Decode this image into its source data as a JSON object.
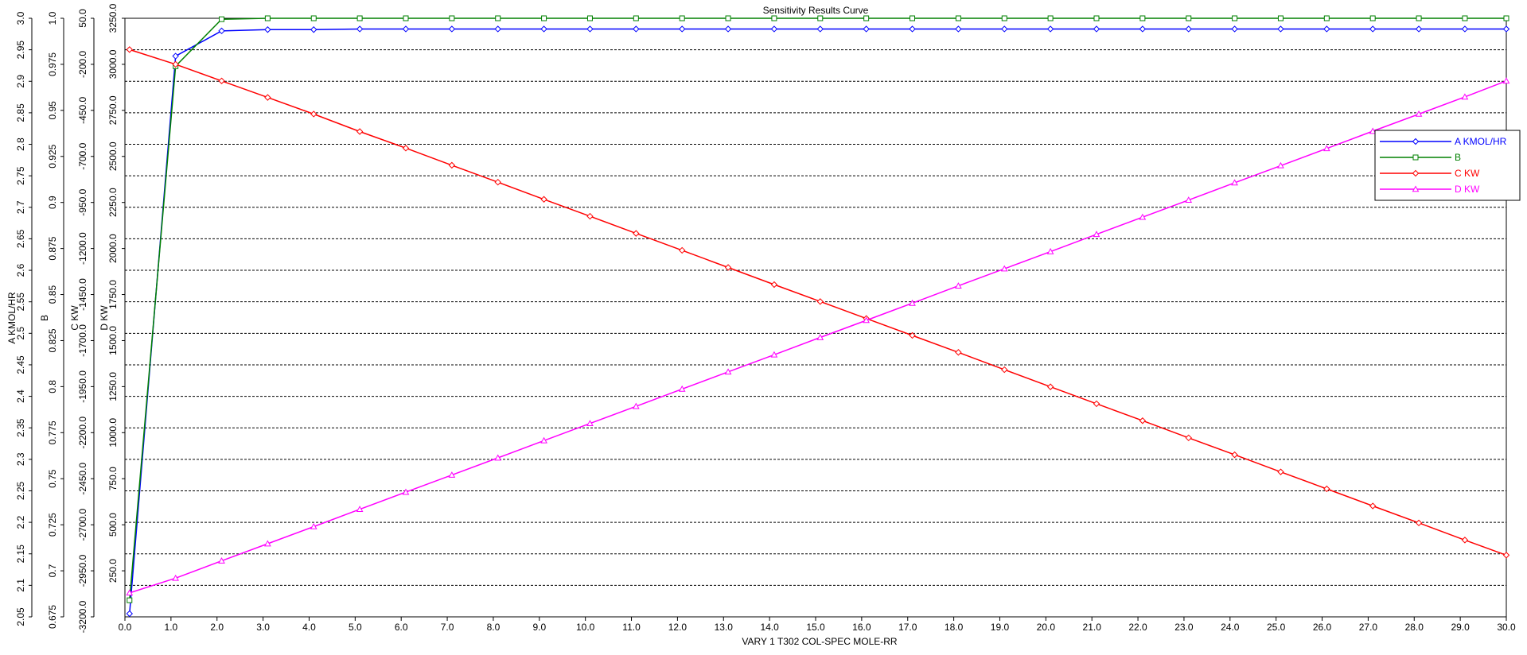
{
  "chart_data": {
    "type": "line",
    "title": "Sensitivity Results Curve",
    "xlabel": "VARY   1 T302 COL-SPEC MOLE-RR",
    "xlim": [
      0.0,
      30.0
    ],
    "xticks": [
      "0.0",
      "1.0",
      "2.0",
      "3.0",
      "4.0",
      "5.0",
      "6.0",
      "7.0",
      "8.0",
      "9.0",
      "10.0",
      "11.0",
      "12.0",
      "13.0",
      "14.0",
      "15.0",
      "16.0",
      "17.0",
      "18.0",
      "19.0",
      "20.0",
      "21.0",
      "22.0",
      "23.0",
      "24.0",
      "25.0",
      "26.0",
      "27.0",
      "28.0",
      "29.0",
      "30.0"
    ],
    "axes": [
      {
        "id": "A",
        "label": "A KMOL/HR",
        "ylim": [
          2.05,
          3.0
        ],
        "ticks": [
          "2.05",
          "2.1",
          "2.15",
          "2.2",
          "2.25",
          "2.3",
          "2.35",
          "2.4",
          "2.45",
          "2.5",
          "2.55",
          "2.6",
          "2.65",
          "2.7",
          "2.75",
          "2.8",
          "2.85",
          "2.9",
          "2.95",
          "3.0"
        ]
      },
      {
        "id": "B",
        "label": "B",
        "ylim": [
          0.675,
          1.0
        ],
        "ticks": [
          "0.675",
          "0.7",
          "0.725",
          "0.75",
          "0.775",
          "0.8",
          "0.825",
          "0.85",
          "0.875",
          "0.9",
          "0.925",
          "0.95",
          "0.975",
          "1.0"
        ]
      },
      {
        "id": "C",
        "label": "C KW",
        "ylim": [
          -3200.0,
          50.0
        ],
        "ticks": [
          "-3200.0",
          "-2950.0",
          "-2700.0",
          "-2450.0",
          "-2200.0",
          "-1950.0",
          "-1700.0",
          "-1450.0",
          "-1200.0",
          "-950.0",
          "-700.0",
          "-450.0",
          "-200.0",
          "50.0"
        ]
      },
      {
        "id": "D",
        "label": "D KW",
        "ylim": [
          0.0,
          3250.0
        ],
        "ticks": [
          "250.0",
          "500.0",
          "750.0",
          "1000.0",
          "1250.0",
          "1500.0",
          "1750.0",
          "2000.0",
          "2250.0",
          "2500.0",
          "2750.0",
          "3000.0",
          "3250.0"
        ]
      }
    ],
    "x": [
      0.1,
      1.1,
      2.1,
      3.1,
      4.1,
      5.1,
      6.1,
      7.1,
      8.1,
      9.1,
      10.1,
      11.1,
      12.1,
      13.1,
      14.1,
      15.1,
      16.1,
      17.1,
      18.1,
      19.1,
      20.1,
      21.1,
      22.1,
      23.1,
      24.1,
      25.1,
      26.1,
      27.1,
      28.1,
      29.1,
      30.0
    ],
    "series": [
      {
        "name": "A KMOL/HR",
        "axis": "A",
        "color": "#0000ff",
        "marker": "diamond",
        "values": [
          2.055,
          2.94,
          2.98,
          2.982,
          2.982,
          2.983,
          2.983,
          2.983,
          2.983,
          2.983,
          2.983,
          2.983,
          2.983,
          2.983,
          2.983,
          2.983,
          2.983,
          2.983,
          2.983,
          2.983,
          2.983,
          2.983,
          2.983,
          2.983,
          2.983,
          2.983,
          2.983,
          2.983,
          2.983,
          2.983,
          2.983
        ]
      },
      {
        "name": "B",
        "axis": "B",
        "color": "#008000",
        "marker": "square",
        "values": [
          0.684,
          0.974,
          0.9995,
          1.0,
          1.0,
          1.0,
          1.0,
          1.0,
          1.0,
          1.0,
          1.0,
          1.0,
          1.0,
          1.0,
          1.0,
          1.0,
          1.0,
          1.0,
          1.0,
          1.0,
          1.0,
          1.0,
          1.0,
          1.0,
          1.0,
          1.0,
          1.0,
          1.0,
          1.0,
          1.0,
          1.0
        ]
      },
      {
        "name": "C KW",
        "axis": "C",
        "color": "#ff0000",
        "marker": "diamond",
        "values": [
          -120,
          -200,
          -290,
          -380,
          -470,
          -565,
          -655,
          -748,
          -840,
          -933,
          -1025,
          -1118,
          -1210,
          -1303,
          -1396,
          -1488,
          -1580,
          -1672,
          -1764,
          -1858,
          -1951,
          -2043,
          -2135,
          -2228,
          -2320,
          -2413,
          -2505,
          -2598,
          -2690,
          -2783,
          -2865
        ]
      },
      {
        "name": "D KW",
        "axis": "D",
        "color": "#ff00ff",
        "marker": "triangle",
        "values": [
          130,
          210,
          304,
          397,
          490,
          584,
          677,
          770,
          863,
          957,
          1050,
          1143,
          1237,
          1330,
          1423,
          1517,
          1610,
          1703,
          1797,
          1890,
          1983,
          2077,
          2170,
          2263,
          2357,
          2450,
          2543,
          2637,
          2730,
          2823,
          2910
        ]
      }
    ],
    "grid": true,
    "legend": "right"
  }
}
